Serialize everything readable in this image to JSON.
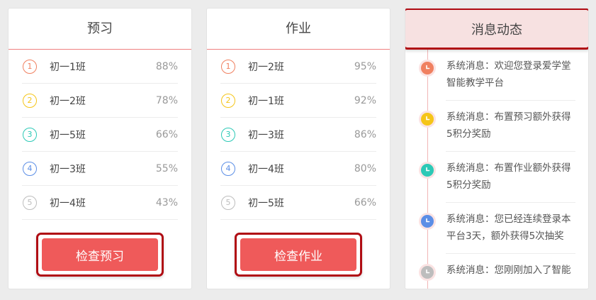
{
  "preview": {
    "title": "预习",
    "rows": [
      {
        "rank": "1",
        "name": "初一1班",
        "pct": "88%",
        "color": "#f08060"
      },
      {
        "rank": "2",
        "name": "初一2班",
        "pct": "78%",
        "color": "#f5c518"
      },
      {
        "rank": "3",
        "name": "初一5班",
        "pct": "66%",
        "color": "#2cc9b6"
      },
      {
        "rank": "4",
        "name": "初一3班",
        "pct": "55%",
        "color": "#5b8ee6"
      },
      {
        "rank": "5",
        "name": "初一4班",
        "pct": "43%",
        "color": "#bdbdbd"
      }
    ],
    "button": "检查预习"
  },
  "homework": {
    "title": "作业",
    "rows": [
      {
        "rank": "1",
        "name": "初一2班",
        "pct": "95%",
        "color": "#f08060"
      },
      {
        "rank": "2",
        "name": "初一1班",
        "pct": "92%",
        "color": "#f5c518"
      },
      {
        "rank": "3",
        "name": "初一3班",
        "pct": "86%",
        "color": "#2cc9b6"
      },
      {
        "rank": "4",
        "name": "初一4班",
        "pct": "80%",
        "color": "#5b8ee6"
      },
      {
        "rank": "5",
        "name": "初一5班",
        "pct": "66%",
        "color": "#bdbdbd"
      }
    ],
    "button": "检查作业"
  },
  "news": {
    "title": "消息动态",
    "items": [
      {
        "line1": "系统消息：欢迎您登录爱学堂",
        "line2": "智能教学平台",
        "color": "#f08060",
        "icon": "clock-icon"
      },
      {
        "line1": "系统消息：布置预习额外获得",
        "line2": "5积分奖励",
        "color": "#f5c518",
        "icon": "clock-icon"
      },
      {
        "line1": "系统消息：布置作业额外获得",
        "line2": "5积分奖励",
        "color": "#2cc9b6",
        "icon": "clock-icon"
      },
      {
        "line1": "系统消息：您已经连续登录本",
        "line2": "平台3天，额外获得5次抽奖",
        "color": "#5b8ee6",
        "icon": "clock-icon"
      },
      {
        "line1": "系统消息：您刚刚加入了智能",
        "line2": "",
        "color": "#bdbdbd",
        "icon": "clock-icon"
      }
    ]
  },
  "colors": {
    "accent": "#ef5a5a",
    "highlight_border": "#b00d14",
    "divider": "#f08080"
  }
}
